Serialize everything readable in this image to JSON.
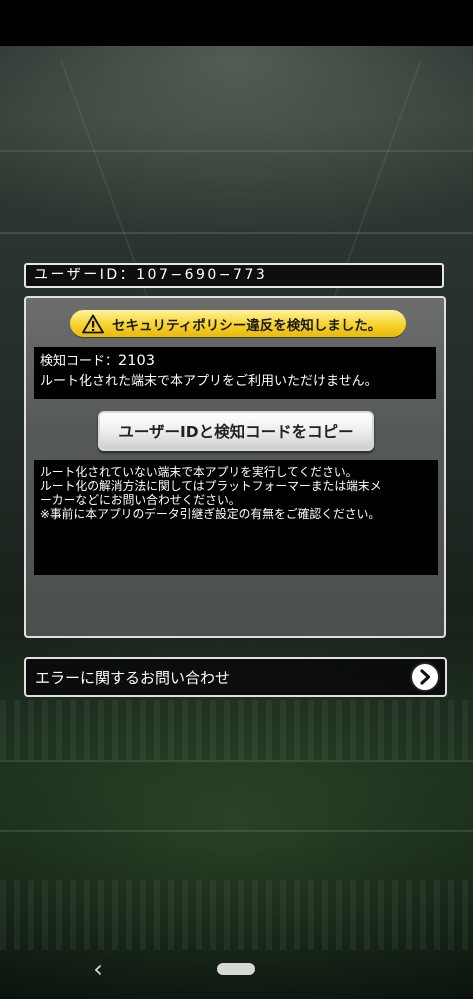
{
  "user_id_bar": {
    "text": "ユーザーID：107−690−773"
  },
  "panel": {
    "warning_banner": "セキュリティポリシー違反を検知しました。",
    "detect_code_label": "検知コード：",
    "detect_code_value": "2103",
    "detect_message": "ルート化された端末で本アプリをご利用いただけません。",
    "copy_button_label": "ユーザーIDと検知コードをコピー",
    "info_lines": [
      "ルート化されていない端末で本アプリを実行してください。",
      "ルート化の解消方法に関してはプラットフォーマーまたは端末メ",
      "ーカーなどにお問い合わせください。",
      "※事前に本アプリのデータ引継ぎ設定の有無をご確認ください。"
    ]
  },
  "contact": {
    "label": "エラーに関するお問い合わせ"
  },
  "nav": {
    "back_glyph": "‹"
  },
  "icons": {
    "warning": "warning-triangle-icon",
    "arrow": "chevron-right-circle-icon",
    "back": "back-icon",
    "home": "home-pill-icon"
  },
  "colors": {
    "banner": "#f7d32a",
    "panel": "#5a5e5c",
    "box": "#000000"
  }
}
